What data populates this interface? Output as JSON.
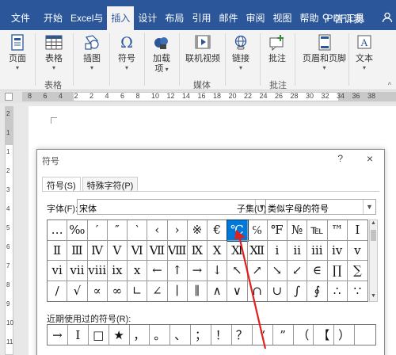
{
  "ribbon_tabs": [
    "文件",
    "开始",
    "Excel与",
    "插入",
    "设计",
    "布局",
    "引用",
    "邮件",
    "审阅",
    "视图",
    "帮助",
    "PDF工具"
  ],
  "active_tab": "插入",
  "tell_me": "告诉我",
  "ribbon": {
    "page": "页面",
    "table": "表格",
    "picture": "插图",
    "symbol": "符号",
    "addins": "加载",
    "addins2": "项",
    "online_video": "联机视频",
    "link": "链接",
    "comment": "批注",
    "header_footer": "页眉和页脚",
    "text": "文本",
    "group_table": "表格",
    "group_media": "媒体",
    "group_comment": "批注"
  },
  "ruler": {
    "h_numbers": [
      "8",
      "6",
      "4",
      "2",
      "2",
      "4",
      "6",
      "8",
      "10",
      "12",
      "14",
      "16",
      "18",
      "20",
      "22",
      "24",
      "26",
      "28",
      "30",
      "32",
      "34",
      "36",
      "38"
    ],
    "v_numbers": [
      "2",
      "1",
      "1",
      "2",
      "3",
      "4",
      "5",
      "6",
      "7",
      "8",
      "9",
      "10",
      "11"
    ]
  },
  "dialog": {
    "title": "符号",
    "help": "?",
    "close": "×",
    "tabs": [
      "符号(S)",
      "特殊字符(P)"
    ],
    "font_label": "字体(F):",
    "font_value": "宋体",
    "subset_label": "子集(U):",
    "subset_value": "类似字母的符号",
    "selected_symbol": "℃",
    "symbols": [
      [
        "…",
        "‰",
        "′",
        "″",
        "‵",
        "‹",
        "›",
        "※",
        "€",
        "℃",
        "℅",
        "℉",
        "№",
        "℡",
        "™",
        "Ⅰ"
      ],
      [
        "Ⅱ",
        "Ⅲ",
        "Ⅳ",
        "Ⅴ",
        "Ⅵ",
        "Ⅶ",
        "Ⅷ",
        "Ⅸ",
        "Ⅹ",
        "Ⅺ",
        "Ⅻ",
        "ⅰ",
        "ⅱ",
        "ⅲ",
        "ⅳ",
        "ⅴ"
      ],
      [
        "ⅵ",
        "ⅶ",
        "ⅷ",
        "ⅸ",
        "ⅹ",
        "←",
        "↑",
        "→",
        "↓",
        "↖",
        "↗",
        "↘",
        "↙",
        "∈",
        "∏",
        "∑"
      ],
      [
        "∕",
        "√",
        "∝",
        "∞",
        "∟",
        "∠",
        "∣",
        "∥",
        "∧",
        "∨",
        "∩",
        "∪",
        "∫",
        "∮",
        "∴",
        "∵"
      ]
    ],
    "recent_label": "近期使用过的符号(R):",
    "recent": [
      "→",
      "Ⅰ",
      "□",
      "★",
      "，",
      "。",
      "、",
      "；",
      "！",
      "？",
      "“",
      "”",
      "（",
      "【",
      "）",
      ""
    ]
  },
  "colors": {
    "ribbon_blue": "#2b579a",
    "selected_cell": "#0078d7",
    "annotation_red": "#e02020"
  }
}
